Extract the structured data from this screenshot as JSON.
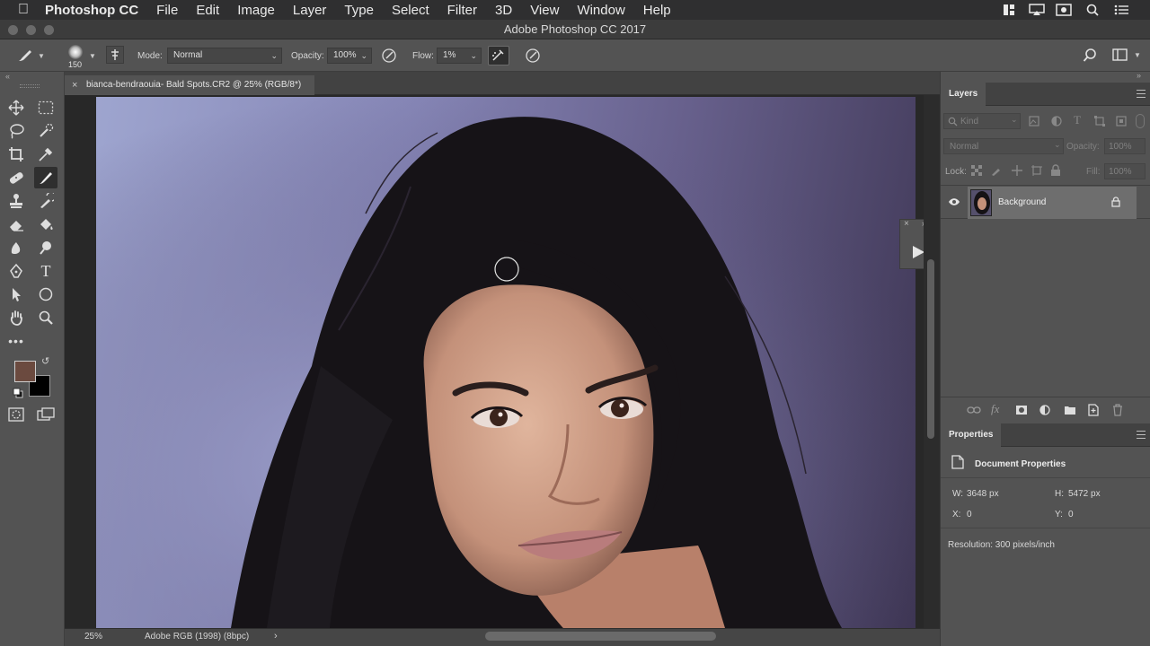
{
  "menubar": {
    "app_name": "Photoshop CC",
    "items": [
      "File",
      "Edit",
      "Image",
      "Layer",
      "Type",
      "Select",
      "Filter",
      "3D",
      "View",
      "Window",
      "Help"
    ]
  },
  "window": {
    "title": "Adobe Photoshop CC 2017"
  },
  "options": {
    "brush_size": "150",
    "mode_label": "Mode:",
    "mode_value": "Normal",
    "opacity_label": "Opacity:",
    "opacity_value": "100%",
    "flow_label": "Flow:",
    "flow_value": "1%"
  },
  "document": {
    "tab_title": "bianca-bendraouia- Bald Spots.CR2 @ 25% (RGB/8*)",
    "zoom": "25%",
    "profile": "Adobe RGB (1998) (8bpc)"
  },
  "colors": {
    "foreground": "#6b4a3f",
    "background": "#000000"
  },
  "layers_panel": {
    "title": "Layers",
    "kind_placeholder": "Kind",
    "blend_mode": "Normal",
    "opacity_label": "Opacity:",
    "opacity_value": "100%",
    "lock_label": "Lock:",
    "fill_label": "Fill:",
    "fill_value": "100%",
    "layers": [
      {
        "name": "Background",
        "visible": true,
        "locked": true
      }
    ]
  },
  "properties_panel": {
    "title": "Properties",
    "section": "Document Properties",
    "w_label": "W:",
    "w_value": "3648 px",
    "h_label": "H:",
    "h_value": "5472 px",
    "x_label": "X:",
    "x_value": "0",
    "y_label": "Y:",
    "y_value": "0",
    "resolution": "Resolution: 300 pixels/inch"
  }
}
